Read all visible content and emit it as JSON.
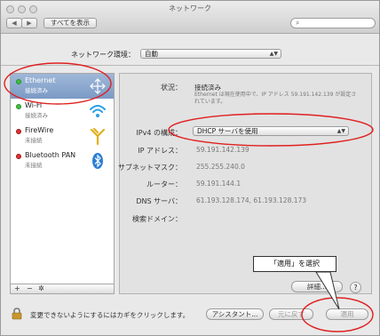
{
  "window": {
    "title": "ネットワーク"
  },
  "toolbar": {
    "back_label": "◀",
    "forward_label": "▶",
    "show_all_label": "すべてを表示",
    "search_placeholder": ""
  },
  "location": {
    "label": "ネットワーク環境：",
    "value": "自動"
  },
  "services": [
    {
      "name": "Ethernet",
      "status": "接続済み",
      "dot_color": "#3fbf3f",
      "icon": "ethernet-icon",
      "selected": true
    },
    {
      "name": "Wi-Fi",
      "status": "接続済み",
      "dot_color": "#3fbf3f",
      "icon": "wifi-icon",
      "selected": false
    },
    {
      "name": "FireWire",
      "status": "未接続",
      "dot_color": "#e03030",
      "icon": "firewire-icon",
      "selected": false
    },
    {
      "name": "Bluetooth PAN",
      "status": "未接続",
      "dot_color": "#e03030",
      "icon": "bluetooth-icon",
      "selected": false
    }
  ],
  "sidebar_toolbar": {
    "add": "+",
    "remove": "−",
    "gear": "✲"
  },
  "detail": {
    "status_label": "状況：",
    "status_value": "接続済み",
    "status_info": "Ethernet は現在使用中で、IP アドレス 59.191.142.139 が設定されています。",
    "ipv4_label": "IPv4 の構成：",
    "ipv4_value": "DHCP サーバを使用",
    "ip_label": "IP アドレス：",
    "ip_value": "59.191.142.139",
    "subnet_label": "サブネットマスク：",
    "subnet_value": "255.255.240.0",
    "router_label": "ルーター：",
    "router_value": "59.191.144.1",
    "dns_label": "DNS サーバ：",
    "dns_value": "61.193.128.174, 61.193.128.173",
    "search_domain_label": "検索ドメイン："
  },
  "buttons": {
    "advanced": "詳細...",
    "help": "?",
    "assistant": "アシスタント...",
    "revert": "元に戻す",
    "apply": "適用"
  },
  "lock_text": "変更できないようにするにはカギをクリックします。",
  "callout": "「適用」を選択",
  "colors": {
    "annotation_red": "#e02020",
    "selection": "#7b9ac5"
  }
}
